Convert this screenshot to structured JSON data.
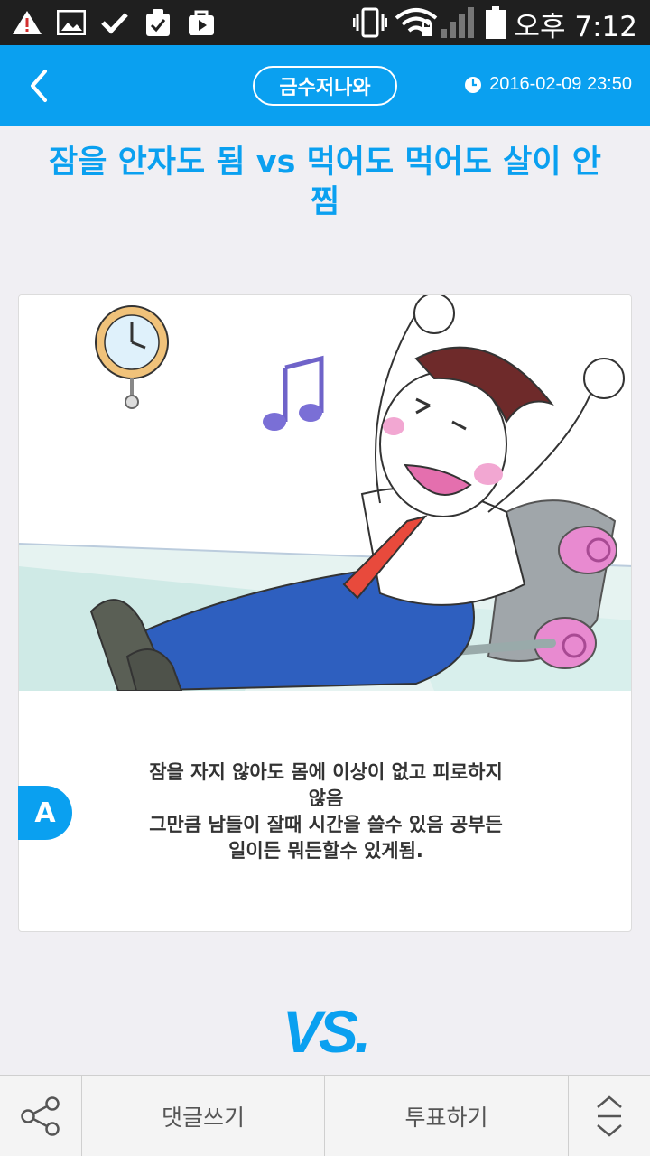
{
  "status_bar": {
    "icons": [
      "warning-icon",
      "image-icon",
      "check-icon",
      "clipboard-icon",
      "play-store-icon",
      "vibrate-icon",
      "wifi-icon",
      "signal-icon",
      "battery-icon"
    ],
    "time": "오후 7:12"
  },
  "header": {
    "back_icon": "chevron-left-icon",
    "category": "금수저나와",
    "date": "2016-02-09 23:50",
    "accent_color": "#0aa0f0"
  },
  "post": {
    "title": "잠을 안자도 됨 vs 먹어도 먹어도 살이 안찜"
  },
  "option_a": {
    "badge": "A",
    "description_lines": [
      "잠을 자지 않아도 몸에 이상이 없고 피로하지",
      "않음",
      "그만큼 남들이 잘때 시간을 쓸수 있음 공부든",
      "일이든 뭐든할수 있게됨."
    ]
  },
  "vs_label": "VS.",
  "bottom_bar": {
    "share_icon": "share-icon",
    "comment_label": "댓글쓰기",
    "vote_label": "투표하기",
    "scroll_icon": "up-down-arrows-icon"
  }
}
